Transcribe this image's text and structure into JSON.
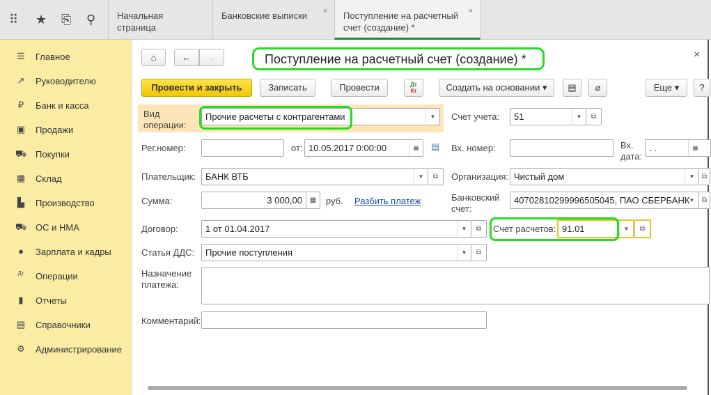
{
  "topbar": {
    "icons": [
      "apps-grid-icon",
      "star-icon",
      "history-icon",
      "search-icon"
    ],
    "tabs": [
      {
        "label": "Начальная страница",
        "closable": false
      },
      {
        "label": "Банковские выписки",
        "closable": true
      },
      {
        "label": "Поступление на расчетный счет (создание) *",
        "closable": true,
        "active": true
      }
    ]
  },
  "sidebar": {
    "items": [
      {
        "label": "Главное",
        "icon": "menu-icon",
        "glyph": "☰"
      },
      {
        "label": "Руководителю",
        "icon": "trend-icon",
        "glyph": "↗"
      },
      {
        "label": "Банк и касса",
        "icon": "ruble-icon",
        "glyph": "₽"
      },
      {
        "label": "Продажи",
        "icon": "bag-icon",
        "glyph": "▣"
      },
      {
        "label": "Покупки",
        "icon": "cart-icon",
        "glyph": "⛟"
      },
      {
        "label": "Склад",
        "icon": "warehouse-icon",
        "glyph": "▦"
      },
      {
        "label": "Производство",
        "icon": "factory-icon",
        "glyph": "▙"
      },
      {
        "label": "ОС и НМА",
        "icon": "truck-icon",
        "glyph": "⛟"
      },
      {
        "label": "Зарплата и кадры",
        "icon": "person-icon",
        "glyph": "●"
      },
      {
        "label": "Операции",
        "icon": "dt-kt-icon",
        "glyph": "Дт"
      },
      {
        "label": "Отчеты",
        "icon": "bar-chart-icon",
        "glyph": "▮"
      },
      {
        "label": "Справочники",
        "icon": "book-icon",
        "glyph": "▤"
      },
      {
        "label": "Администрирование",
        "icon": "gear-icon",
        "glyph": "⚙"
      }
    ]
  },
  "form": {
    "title": "Поступление на расчетный счет (создание) *",
    "close": "×",
    "toolbar": {
      "post_close": "Провести и закрыть",
      "save": "Записать",
      "post": "Провести",
      "dtkt_top": "Дт",
      "dtkt_bottom": "Кт",
      "create_based": "Создать на основании ▾",
      "more": "Еще ▾",
      "help": "?"
    },
    "fields": {
      "op_type_label": "Вид операции:",
      "op_type": "Прочие расчеты с контрагентами",
      "account_label": "Счет учета:",
      "account": "51",
      "reg_label": "Рег.номер:",
      "reg": "",
      "from_label": "от:",
      "date": "10.05.2017  0:00:00",
      "in_num_label": "Вх. номер:",
      "in_num": "",
      "in_date_label": "Вх. дата:",
      "in_date": " .  .",
      "payer_label": "Плательщик:",
      "payer": "БАНК ВТБ",
      "org_label": "Организация:",
      "org": "Чистый дом",
      "sum_label": "Сумма:",
      "sum": "3 000,00",
      "currency": "руб.",
      "split_link": "Разбить платеж",
      "bank_acc_label": "Банковский счет:",
      "bank_acc": "40702810299996505045, ПАО СБЕРБАНК",
      "contract_label": "Договор:",
      "contract": "1 от 01.04.2017",
      "settle_label": "Счет расчетов:",
      "settle": "91.01",
      "dds_label": "Статья ДДС:",
      "dds": "Прочие поступления",
      "purpose_label": "Назначение платежа:",
      "purpose": "",
      "comment_label": "Комментарий:",
      "comment": ""
    }
  },
  "colors": {
    "highlight_green": "#22dd22",
    "yellow_button": "#f5cc00",
    "sidebar": "#fbeca4",
    "orange_highlight": "#fde5b8",
    "settle_border": "#f0c020"
  }
}
